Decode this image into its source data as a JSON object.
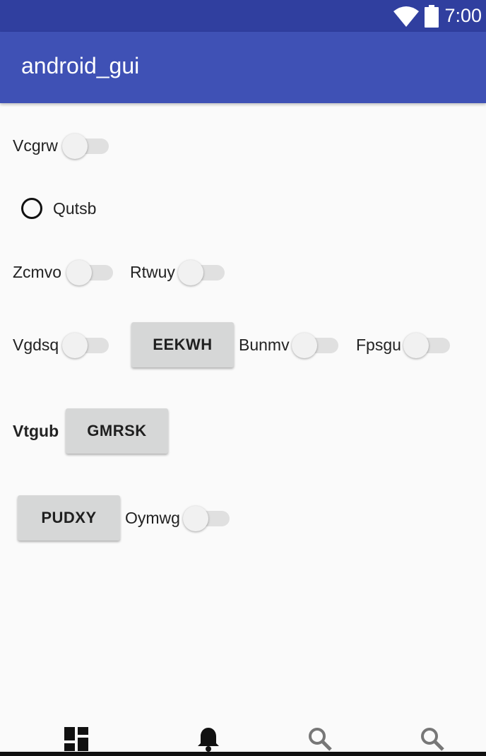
{
  "status_bar": {
    "time": "7:00",
    "icons": [
      "wifi-icon",
      "battery-icon"
    ]
  },
  "app_bar": {
    "title": "android_gui"
  },
  "rows": {
    "r1": {
      "switch_label": "Vcgrw"
    },
    "r2": {
      "radio_label": "Qutsb"
    },
    "r3": {
      "switch1_label": "Zcmvo",
      "switch2_label": "Rtwuy"
    },
    "r4": {
      "switch1_label": "Vgdsq",
      "button": "EEKWH",
      "switch2_label": "Bunmv",
      "switch3_label": "Fpsgu"
    },
    "r5": {
      "label": "Vtgub",
      "button": "GMRSK"
    },
    "r6": {
      "button": "PUDXY",
      "switch_label": "Oymwg"
    }
  },
  "bottom_nav": {
    "items": [
      "dashboard-icon",
      "notifications-icon",
      "search-icon",
      "search-icon"
    ]
  },
  "colors": {
    "status_bar": "#303f9f",
    "app_bar": "#3f51b5",
    "background": "#fafafa",
    "button": "#d6d7d7"
  }
}
